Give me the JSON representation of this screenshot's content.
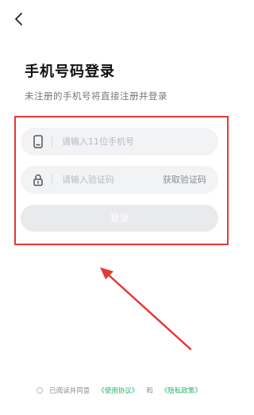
{
  "header": {
    "back_icon": "chevron-left-icon"
  },
  "main": {
    "title": "手机号码登录",
    "subtitle": "未注册的手机号将直接注册并登录"
  },
  "form": {
    "phone": {
      "icon": "phone-icon",
      "placeholder": "请输入11位手机号",
      "value": ""
    },
    "code": {
      "icon": "lock-icon",
      "placeholder": "请输入验证码",
      "value": "",
      "get_code_label": "获取验证码"
    },
    "login_label": "登录"
  },
  "agreement": {
    "prefix": "已阅读并同意",
    "terms_link": "《使用协议》",
    "conjunction": "和",
    "privacy_link": "《隐私政策》"
  },
  "colors": {
    "accent_link": "#23b26d",
    "highlight_border": "#e53935",
    "field_background": "#f2f3f5",
    "button_disabled": "#e9eaec"
  }
}
